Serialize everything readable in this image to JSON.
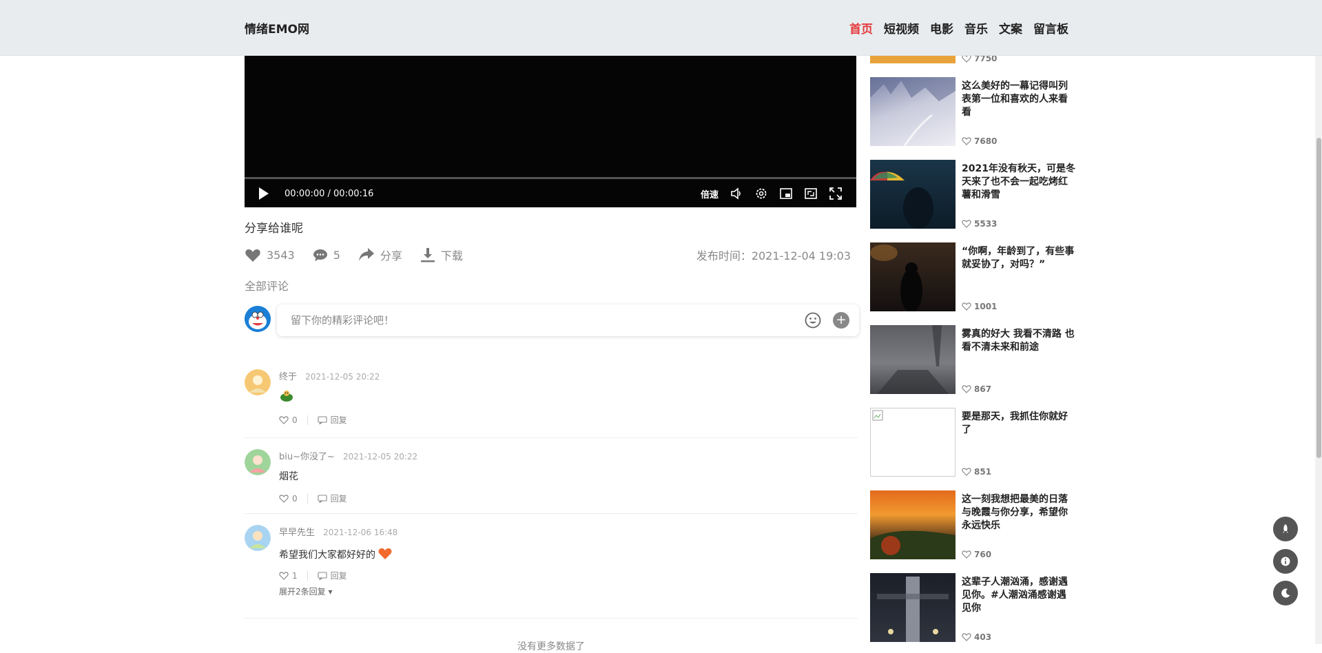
{
  "header": {
    "logo": "情绪EMO网",
    "nav": [
      {
        "label": "首页",
        "active": true
      },
      {
        "label": "短视频",
        "active": false
      },
      {
        "label": "电影",
        "active": false
      },
      {
        "label": "音乐",
        "active": false
      },
      {
        "label": "文案",
        "active": false
      },
      {
        "label": "留言板",
        "active": false
      }
    ]
  },
  "video": {
    "time": "00:00:00 / 00:00:16",
    "speed_label": "倍速",
    "title": "分享给谁呢",
    "likes": "3543",
    "comments": "5",
    "share_label": "分享",
    "download_label": "下载",
    "publish_time": "发布时间：2021-12-04 19:03"
  },
  "comments_section": {
    "heading": "全部评论",
    "placeholder": "留下你的精彩评论吧！",
    "plus_label": "+",
    "items": [
      {
        "user": "终于",
        "time": "2021-12-05 20:22",
        "text": "",
        "emoji": "turtle",
        "likes": "0",
        "reply_label": "回复"
      },
      {
        "user": "biu~你没了~",
        "time": "2021-12-05 20:22",
        "text": "烟花",
        "likes": "0",
        "reply_label": "回复"
      },
      {
        "user": "早早先生",
        "time": "2021-12-06 16:48",
        "text": "希望我们大家都好好的",
        "emoji": "heart",
        "likes": "1",
        "reply_label": "回复",
        "expand_label": "展开2条回复"
      }
    ],
    "no_more": "没有更多数据了"
  },
  "sidebar": {
    "items": [
      {
        "title": "",
        "likes": "7750",
        "thumb": "orange"
      },
      {
        "title": "这么美好的一幕记得叫列表第一位和喜欢的人来看看",
        "likes": "7680",
        "thumb": "snow"
      },
      {
        "title": "2021年没有秋天，可是冬天来了也不会一起吃烤红薯和滑雪",
        "likes": "5533",
        "thumb": "umbrella"
      },
      {
        "title": "“你啊，年龄到了，有些事就妥协了，对吗？”",
        "likes": "1001",
        "thumb": "dark-girl"
      },
      {
        "title": "雾真的好大 我看不清路 也看不清未来和前途",
        "likes": "867",
        "thumb": "fog"
      },
      {
        "title": "要是那天，我抓住你就好了",
        "likes": "851",
        "thumb": "broken"
      },
      {
        "title": "这一刻我想把最美的日落与晚霞与你分享，希望你永远快乐",
        "likes": "760",
        "thumb": "sunset"
      },
      {
        "title": "这辈子人潮汹涌，感谢遇见你。#人潮汹涌感谢遇见你",
        "likes": "403",
        "thumb": "night-tower"
      }
    ]
  }
}
